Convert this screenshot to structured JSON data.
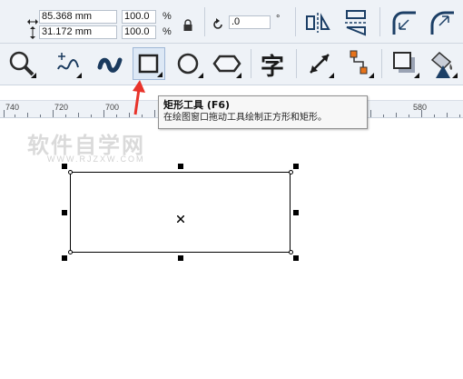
{
  "property_bar": {
    "width_value": "85.368 mm",
    "height_value": "31.172 mm",
    "scale_x": "100.0",
    "scale_y": "100.0",
    "percent_symbol": "%",
    "rotation_value": ".0",
    "degree_symbol": "°"
  },
  "toolbox": {
    "active_tool": "rectangle-tool",
    "tools": [
      "zoom-tool",
      "freehand-tool",
      "artistic-media-tool",
      "rectangle-tool",
      "ellipse-tool",
      "polygon-tool",
      "text-tool",
      "dimension-tool",
      "connector-tool",
      "drop-shadow-tool",
      "fill-tool"
    ]
  },
  "ruler": {
    "labels": [
      "740",
      "720",
      "700",
      "580"
    ]
  },
  "tooltip": {
    "title": "矩形工具 (F6)",
    "description": "在绘图窗口拖动工具绘制正方形和矩形。"
  },
  "watermark": {
    "main": "软件自学网",
    "url": "WWW.RJZXW.COM"
  },
  "colors": {
    "arrow": "#e8332a",
    "toolbar_bg": "#eef2f7",
    "selection": "#000000"
  }
}
